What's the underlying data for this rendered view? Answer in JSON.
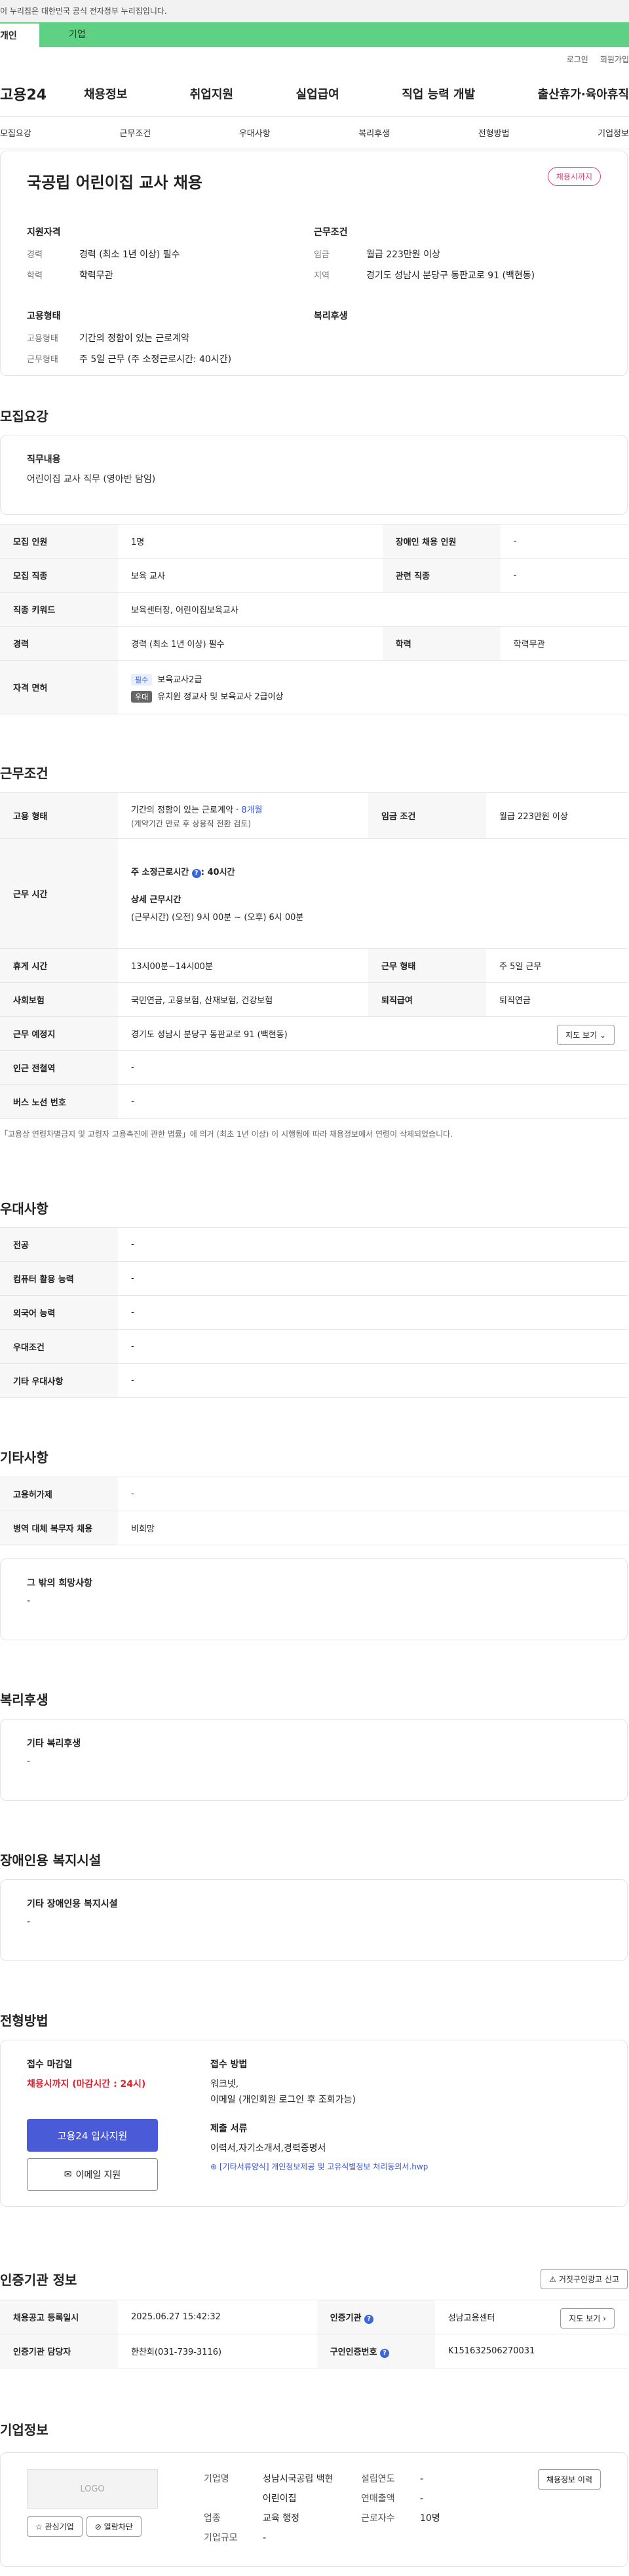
{
  "gov_banner": "이 누리집은 대한민국 공식 전자정부 누리집입니다.",
  "tabs": [
    "개인",
    "기업"
  ],
  "util": [
    "로그인",
    "회원가입"
  ],
  "gnb": {
    "logo": "고용24",
    "menu": [
      "채용정보",
      "취업지원",
      "실업급여",
      "직업 능력 개발",
      "출산휴가·육아휴직"
    ]
  },
  "anchors": [
    "모집요강",
    "근무조건",
    "우대사항",
    "복리후생",
    "전형방법",
    "기업정보"
  ],
  "job": {
    "title": "국공립 어린이집 교사 채용",
    "status": "채용시까지",
    "qual_title": "지원자격",
    "qual": [
      {
        "k": "경력",
        "v": "경력 (최소 1년 이상) 필수"
      },
      {
        "k": "학력",
        "v": "학력무관"
      }
    ],
    "cond_title": "근무조건",
    "cond": [
      {
        "k": "임금",
        "v": "월급 223만원 이상"
      },
      {
        "k": "지역",
        "v": "경기도 성남시 분당구 동판교로 91 (백현동)"
      }
    ],
    "emp_title": "고용형태",
    "emp": [
      {
        "k": "고용형태",
        "v": "기간의 정함이 있는 근로계약"
      },
      {
        "k": "근무형태",
        "v": "주 5일 근무 (주 소정근로시간: 40시간)"
      }
    ],
    "welfare_title": "복리후생"
  },
  "recruit": {
    "title": "모집요강",
    "duty_title": "직무내용",
    "duty": "어린이집 교사 직무 (영아반 담임)",
    "rows": {
      "count_k": "모집 인원",
      "count_v": "1명",
      "disabled_k": "장애인 채용 인원",
      "disabled_v": "-",
      "job_k": "모집 직종",
      "job_v": "보육 교사",
      "rel_k": "관련 직종",
      "rel_v": "-",
      "kw_k": "직종 키워드",
      "kw_v": "보육센터장, 어린이집보육교사",
      "career_k": "경력",
      "career_v": "경력 (최소 1년 이상) 필수",
      "edu_k": "학력",
      "edu_v": "학력무관",
      "lic_k": "자격 면허",
      "lic1_tag": "필수",
      "lic1": "보육교사2급",
      "lic2_tag": "우대",
      "lic2": "유치원 정교사 및 보육교사 2급이상"
    }
  },
  "work": {
    "title": "근무조건",
    "type_k": "고용 형태",
    "type_v": "기간의 정함이 있는 근로계약 · ",
    "type_months": "8개월",
    "type_note": "(계약기간 만료 후 상용직 전환 검토)",
    "wage_k": "임금 조건",
    "wage_v": "월급 223만원 이상",
    "hours_k": "근무 시간",
    "hours_main_label": "주 소정근로시간",
    "hours_main_value": ": 40시간",
    "hours_detail_label": "상세 근무시간",
    "hours_detail": "(근무시간) (오전) 9시 00분 ~ (오후) 6시 00분",
    "break_k": "휴게 시간",
    "break_v": "13시00분~14시00분",
    "form_k": "근무 형태",
    "form_v": "주 5일 근무",
    "ins_k": "사회보험",
    "ins_v": "국민연금, 고용보험, 산재보험, 건강보험",
    "ret_k": "퇴직급여",
    "ret_v": "퇴직연금",
    "loc_k": "근무 예정지",
    "loc_v": "경기도 성남시 분당구 동판교로 91 (백현동)",
    "map_btn": "지도 보기",
    "sub_k": "인근 전철역",
    "sub_v": "-",
    "bus_k": "버스 노선 번호",
    "bus_v": "-",
    "note": "「고용상 연령차별금지 및 고령자 고용촉진에 관한 법률」에 의거 (최초 1년 이상) 이 시행됨에 따라 채용정보에서 연령이 삭제되었습니다."
  },
  "pref": {
    "title": "우대사항",
    "rows": [
      {
        "k": "전공",
        "v": "-"
      },
      {
        "k": "컴퓨터 활용 능력",
        "v": "-"
      },
      {
        "k": "외국어 능력",
        "v": "-"
      },
      {
        "k": "우대조건",
        "v": "-"
      },
      {
        "k": "기타 우대사항",
        "v": "-"
      }
    ]
  },
  "etc": {
    "title": "기타사항",
    "rows": [
      {
        "k": "고용허가제",
        "v": "-"
      },
      {
        "k": "병역 대체 복무자 채용",
        "v": "비희망"
      }
    ],
    "other_title": "그 밖의 희망사항",
    "other_v": "-"
  },
  "welfare": {
    "title": "복리후생",
    "box_title": "기타 복리후생",
    "box_v": "-"
  },
  "facility": {
    "title": "장애인용 복지시설",
    "box_title": "기타 장애인용 복지시설",
    "box_v": "-"
  },
  "selection": {
    "title": "전형방법",
    "deadline_title": "접수 마감일",
    "deadline": "채용시까지 (마감시간 : 24시)",
    "apply_btn": "고용24 입사지원",
    "email_btn": "이메일 지원",
    "method_title": "접수 방법",
    "method": "워크넷,",
    "method2": "이메일 (개인회원 로그인 후 조회가능)",
    "docs_title": "제출 서류",
    "docs": "이력서,자기소개서,경력증명서",
    "file": "[기타서류양식] 개인정보제공 및 고유식별정보 처리동의서.hwp"
  },
  "cert": {
    "title": "인증기관 정보",
    "report_btn": "거짓구인광고 신고",
    "reg_k": "채용공고 등록일시",
    "reg_v": "2025.06.27 15:42:32",
    "org_k": "인증기관",
    "org_v": "성남고용센터",
    "map_btn": "지도 보기",
    "mgr_k": "인증기관 담당자",
    "mgr_v": "한찬희(031-739-3116)",
    "cid_k": "구인인증번호",
    "cid_v": "K151632506270031"
  },
  "company": {
    "title": "기업정보",
    "logo": "LOGO",
    "fav_btn": "관심기업",
    "block_btn": "열람차단",
    "history_btn": "채용정보 이력",
    "name_k": "기업명",
    "name_v": "성남시국공립 백현어린이집",
    "industry_k": "업종",
    "industry_v": "교육 행정",
    "size_k": "기업규모",
    "size_v": "-",
    "founded_k": "설립연도",
    "founded_v": "-",
    "sales_k": "연매출액",
    "sales_v": "-",
    "emp_k": "근로자수",
    "emp_v": "10명"
  }
}
